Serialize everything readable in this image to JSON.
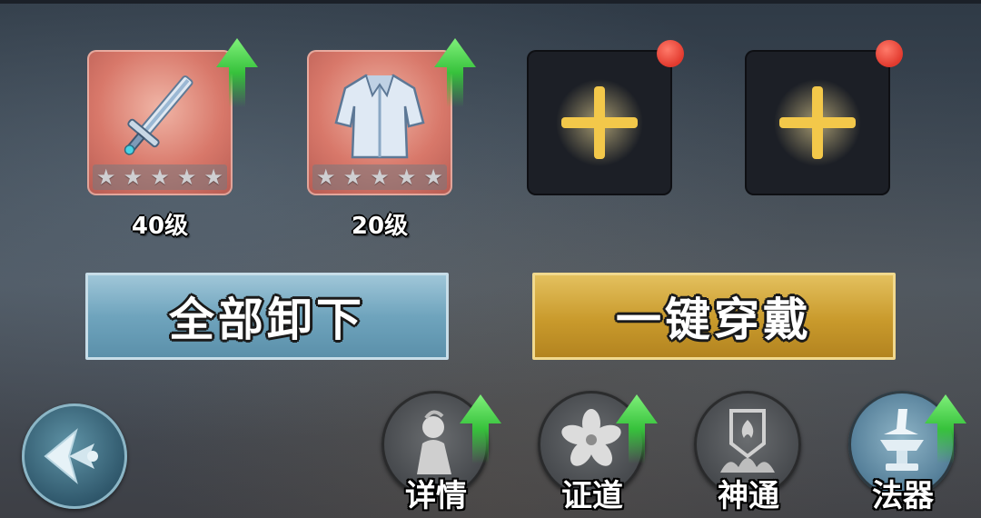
{
  "equipment": {
    "slots": [
      {
        "type": "weapon",
        "icon": "sword-icon",
        "level": "40级",
        "stars": 5,
        "upgrade": true
      },
      {
        "type": "armor",
        "icon": "robe-icon",
        "level": "20级",
        "stars": 5,
        "upgrade": true
      },
      {
        "type": "empty",
        "icon": "plus-icon",
        "notification": true
      },
      {
        "type": "empty",
        "icon": "plus-icon",
        "notification": true
      }
    ]
  },
  "actions": {
    "unequip_all": "全部卸下",
    "equip_all": "一键穿戴"
  },
  "nav": {
    "back_icon": "back-arrow-icon",
    "tabs": [
      {
        "label": "详情",
        "icon": "character-icon",
        "upgrade": true
      },
      {
        "label": "证道",
        "icon": "flower-icon",
        "upgrade": true
      },
      {
        "label": "神通",
        "icon": "shield-flame-icon",
        "upgrade": false
      },
      {
        "label": "法器",
        "icon": "anvil-hammer-icon",
        "upgrade": true
      }
    ]
  },
  "colors": {
    "upgrade_arrow": "#37c23c",
    "notification_dot": "#e23a2e",
    "plus_glow": "#f3c84a",
    "slot_filled_bg": "#d8786a"
  }
}
